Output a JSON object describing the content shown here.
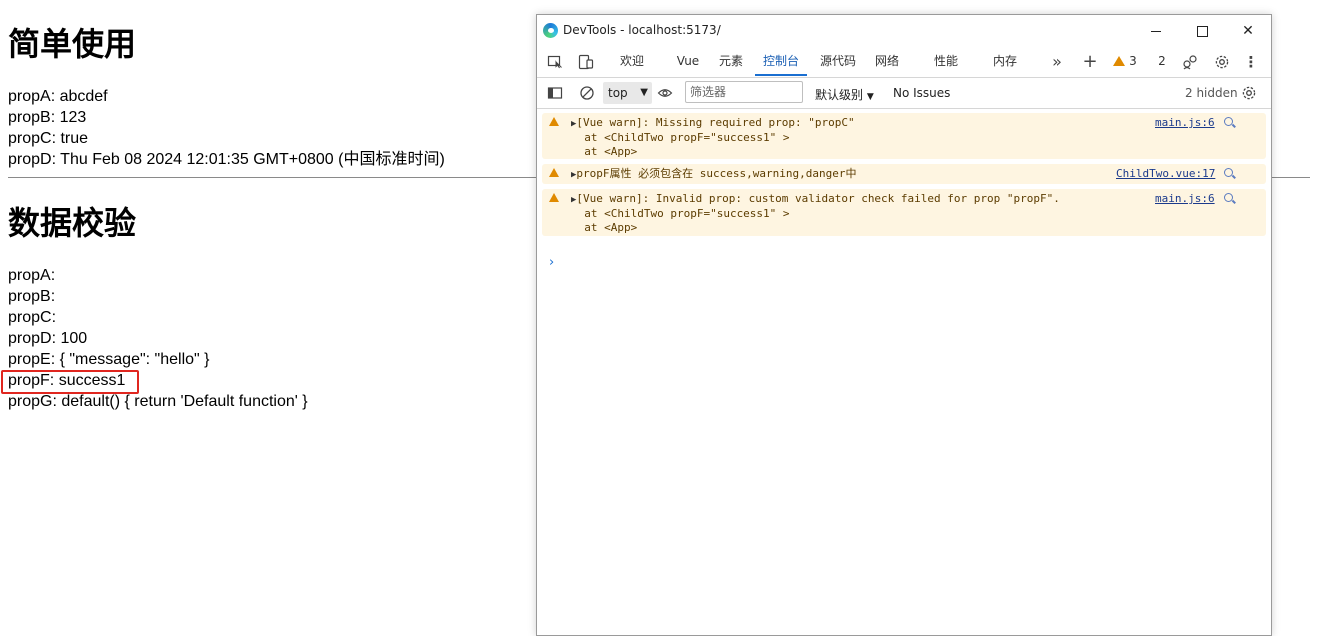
{
  "page": {
    "heading1": "简单使用",
    "simple_lines": [
      "propA: abcdef",
      "propB: 123",
      "propC: true",
      "propD: Thu Feb 08 2024 12:01:35 GMT+0800 (中国标准时间)"
    ],
    "heading2": "数据校验",
    "validate_lines": [
      "propA:",
      "propB:",
      "propC:",
      "propD: 100",
      "propE: { \"message\": \"hello\" }",
      "propF: success1",
      "propG: default() { return 'Default function' }"
    ],
    "highlight_color": "#e0261f"
  },
  "devtools": {
    "window_title": "DevTools - localhost:5173/",
    "window_controls": {
      "minimize": "minimize",
      "maximize": "maximize",
      "close": "✕"
    },
    "tabs": [
      {
        "label": "欢迎",
        "active": false
      },
      {
        "label": "Vue",
        "active": false
      },
      {
        "label": "元素",
        "active": false
      },
      {
        "label": "控制台",
        "active": true
      },
      {
        "label": "源代码",
        "active": false
      },
      {
        "label": "网络",
        "active": false
      },
      {
        "label": "性能",
        "active": false
      },
      {
        "label": "内存",
        "active": false
      }
    ],
    "more_tabs_icon": "»",
    "add_tab_icon": "+",
    "warning_count": "3",
    "issues_count": "2",
    "toolbar": {
      "context": "top",
      "filter_placeholder": "筛选器",
      "levels": "默认级别",
      "no_issues": "No Issues",
      "hidden": "2 hidden"
    },
    "messages": [
      {
        "lines": [
          "[Vue warn]: Missing required prop: \"propC\"",
          "  at <ChildTwo propF=\"success1\" >",
          "  at <App>"
        ],
        "source": "main.js:6"
      },
      {
        "lines": [
          "propF属性 必须包含在 success,warning,danger中"
        ],
        "source": "ChildTwo.vue:17"
      },
      {
        "lines": [
          "[Vue warn]: Invalid prop: custom validator check failed for prop \"propF\".",
          "  at <ChildTwo propF=\"success1\" >",
          "  at <App>"
        ],
        "source": "main.js:6"
      }
    ],
    "prompt_symbol": "›",
    "colors": {
      "warning_bg": "#fef5e1",
      "warning_icon": "#e08a00",
      "active_tab": "#1a6fd1"
    }
  }
}
